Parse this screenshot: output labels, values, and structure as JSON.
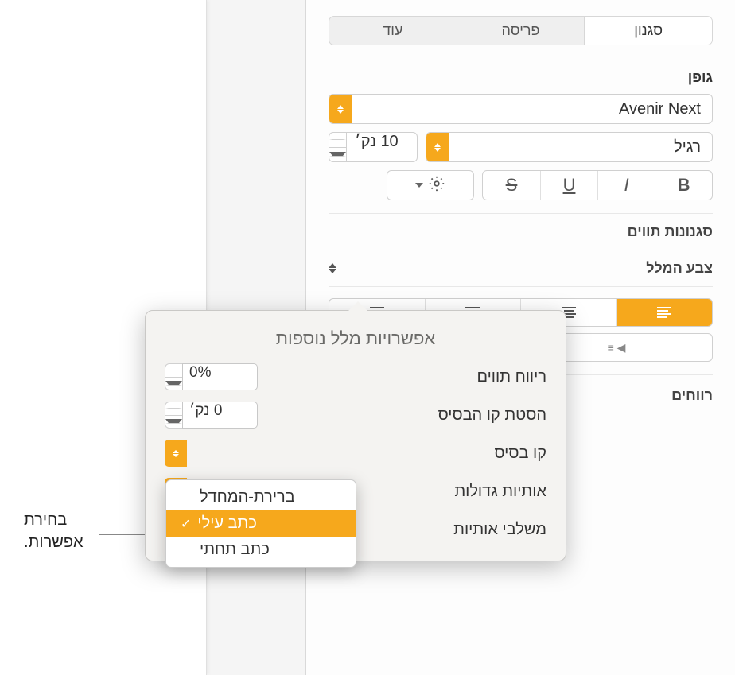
{
  "tabs": {
    "style": "סגנון",
    "layout": "פריסה",
    "more": "עוד"
  },
  "font": {
    "section": "גופן",
    "family": "Avenir Next",
    "weight": "רגיל",
    "size": "10 נק׳",
    "char_styles": "סגנונות תווים",
    "text_color": "צבע המלל",
    "spacing": "רווחים"
  },
  "popover": {
    "title": "אפשרויות מלל נוספות",
    "char_spacing": {
      "label": "ריווח תווים",
      "value": "0%"
    },
    "baseline_shift": {
      "label": "הסטת קו הבסיס",
      "value": "0 נק׳"
    },
    "baseline": {
      "label": "קו בסיס"
    },
    "caps": {
      "label": "אותיות גדולות"
    },
    "ligatures": {
      "label": "משלבי אותיות",
      "value": "ברירת-המחדל"
    }
  },
  "dropdown": {
    "default": "ברירת-המחדל",
    "superscript": "כתב עילי",
    "subscript": "כתב תחתי"
  },
  "callout": {
    "line1": "בחירת",
    "line2": "אפשרות."
  }
}
